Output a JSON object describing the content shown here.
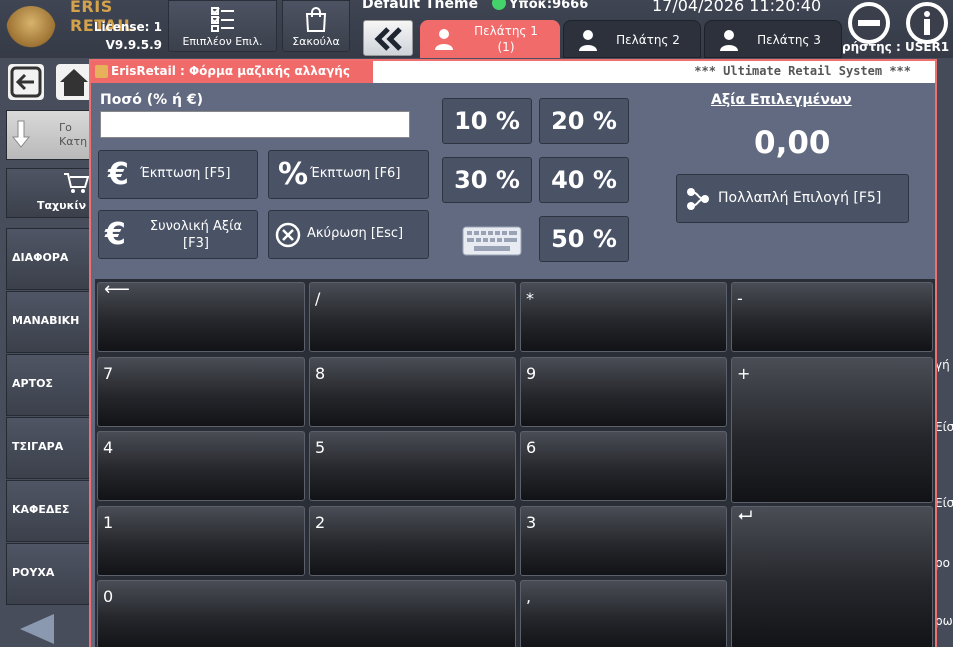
{
  "header": {
    "brand": "ERIS RETAIL",
    "license": "License: 1",
    "version": "V9.9.5.9",
    "more_options_label": "Επιπλέον Επιλ.",
    "bag_label": "Σακούλα",
    "theme": "Default Theme",
    "branch": "Υποκ:9666",
    "datetime": "17/04/2026 11:20:40",
    "user_label": "ρήστης : USER1",
    "tabs": [
      {
        "label": "Πελάτης 1\n(1)",
        "active": true
      },
      {
        "label": "Πελάτης 2",
        "active": false
      },
      {
        "label": "Πελάτης 3",
        "active": false
      }
    ]
  },
  "sidebar": {
    "top_button_label": "Γο\nΚατη",
    "quick_button_label": "Ταχυκίν",
    "categories": [
      "ΔΙΑΦΟΡΑ",
      "ΜΑΝΑΒΙΚΗ",
      "ΑΡΤΟΣ",
      "ΤΣΙΓΑΡΑ",
      "ΚΑΦΕΔΕΣ",
      "ΡΟΥΧΑ"
    ]
  },
  "right_edge": {
    "labels": [
      "γή",
      "Είσ",
      "Είσ",
      "ρο",
      "ρω"
    ]
  },
  "dialog": {
    "title": "ErisRetail : Φόρμα μαζικής αλλαγής",
    "system_label": "*** Ultimate Retail System ***",
    "amount_label": "Ποσό (% ή €)",
    "amount_value": "",
    "buttons": {
      "discount_euro": "Έκπτωση [F5]",
      "discount_percent": "Έκπτωση [F6]",
      "total_value": "Συνολική Αξία\n[F3]",
      "cancel": "Ακύρωση [Esc]",
      "multi_select": "Πολλαπλή Επιλογή [F5]"
    },
    "percent_buttons": [
      "10 %",
      "20 %",
      "30 %",
      "40 %",
      "50 %"
    ],
    "selected_value_title": "Αξία Επιλεγμένων",
    "selected_value": "0,00"
  },
  "keypad": {
    "backspace": "⟵",
    "divide": "/",
    "multiply": "*",
    "minus": "-",
    "plus": "+",
    "enter": "⮠",
    "comma": ",",
    "digits": [
      "7",
      "8",
      "9",
      "4",
      "5",
      "6",
      "1",
      "2",
      "3",
      "0"
    ]
  },
  "colors": {
    "accent_tab": "#f26b6b",
    "dialog_bg": "#616a80",
    "status_online": "#44d26a",
    "brand_gold": "#d4a24c"
  }
}
